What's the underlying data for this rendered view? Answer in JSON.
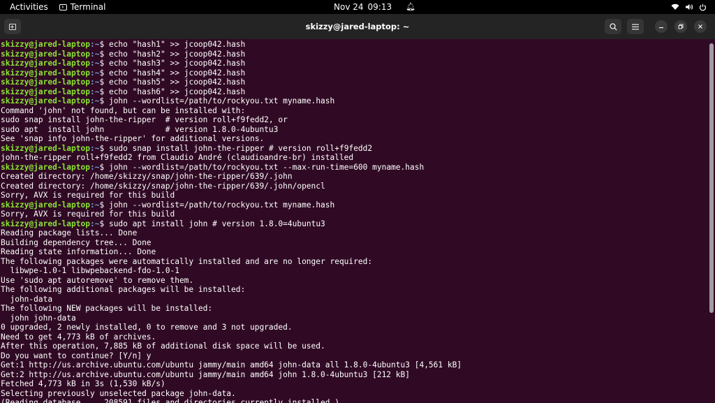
{
  "topbar": {
    "activities": "Activities",
    "app_name": "Terminal",
    "date": "Nov 24",
    "time": "09:13",
    "icons": [
      "bell-icon",
      "wifi-icon",
      "volume-icon",
      "power-icon"
    ]
  },
  "window": {
    "title": "skizzy@jared-laptop: ~",
    "icons": [
      "new-tab-icon",
      "search-icon",
      "hamburger-menu-icon",
      "minimize-icon",
      "maximize-icon",
      "close-icon"
    ]
  },
  "colors": {
    "background": "#300a24",
    "prompt_user": "#8ae234",
    "prompt_path": "#729fcf",
    "text": "#ffffff"
  },
  "prompt": {
    "user_host": "skizzy@jared-laptop",
    "path": ":~",
    "symbol": "$ "
  },
  "terminal_lines": [
    {
      "type": "cmd",
      "text": "echo \"hash1\" >> jcoop042.hash"
    },
    {
      "type": "cmd",
      "text": "echo \"hash2\" >> jcoop042.hash"
    },
    {
      "type": "cmd",
      "text": "echo \"hash3\" >> jcoop042.hash"
    },
    {
      "type": "cmd",
      "text": "echo \"hash4\" >> jcoop042.hash"
    },
    {
      "type": "cmd",
      "text": "echo \"hash5\" >> jcoop042.hash"
    },
    {
      "type": "cmd",
      "text": "echo \"hash6\" >> jcoop042.hash"
    },
    {
      "type": "cmd",
      "text": "john --wordlist=/path/to/rockyou.txt myname.hash"
    },
    {
      "type": "out",
      "text": "Command 'john' not found, but can be installed with:"
    },
    {
      "type": "out",
      "text": "sudo snap install john-the-ripper  # version roll+f9fedd2, or"
    },
    {
      "type": "out",
      "text": "sudo apt  install john             # version 1.8.0-4ubuntu3"
    },
    {
      "type": "out",
      "text": "See 'snap info john-the-ripper' for additional versions."
    },
    {
      "type": "cmd",
      "text": "sudo snap install john-the-ripper # version roll+f9fedd2"
    },
    {
      "type": "out",
      "text": "john-the-ripper roll+f9fedd2 from Claudio André (claudioandre-br) installed"
    },
    {
      "type": "cmd",
      "text": "john --wordlist=/path/to/rockyou.txt --max-run-time=600 myname.hash"
    },
    {
      "type": "out",
      "text": "Created directory: /home/skizzy/snap/john-the-ripper/639/.john"
    },
    {
      "type": "out",
      "text": "Created directory: /home/skizzy/snap/john-the-ripper/639/.john/opencl"
    },
    {
      "type": "out",
      "text": "Sorry, AVX is required for this build"
    },
    {
      "type": "cmd",
      "text": "john --wordlist=/path/to/rockyou.txt myname.hash"
    },
    {
      "type": "out",
      "text": "Sorry, AVX is required for this build"
    },
    {
      "type": "cmd",
      "text": "sudo apt install john # version 1.8.0=4ubuntu3"
    },
    {
      "type": "out",
      "text": "Reading package lists... Done"
    },
    {
      "type": "out",
      "text": "Building dependency tree... Done"
    },
    {
      "type": "out",
      "text": "Reading state information... Done"
    },
    {
      "type": "out",
      "text": "The following packages were automatically installed and are no longer required:"
    },
    {
      "type": "out",
      "text": "  libwpe-1.0-1 libwpebackend-fdo-1.0-1"
    },
    {
      "type": "out",
      "text": "Use 'sudo apt autoremove' to remove them."
    },
    {
      "type": "out",
      "text": "The following additional packages will be installed:"
    },
    {
      "type": "out",
      "text": "  john-data"
    },
    {
      "type": "out",
      "text": "The following NEW packages will be installed:"
    },
    {
      "type": "out",
      "text": "  john john-data"
    },
    {
      "type": "out",
      "text": "0 upgraded, 2 newly installed, 0 to remove and 3 not upgraded."
    },
    {
      "type": "out",
      "text": "Need to get 4,773 kB of archives."
    },
    {
      "type": "out",
      "text": "After this operation, 7,885 kB of additional disk space will be used."
    },
    {
      "type": "out",
      "text": "Do you want to continue? [Y/n] y"
    },
    {
      "type": "out",
      "text": "Get:1 http://us.archive.ubuntu.com/ubuntu jammy/main amd64 john-data all 1.8.0-4ubuntu3 [4,561 kB]"
    },
    {
      "type": "out",
      "text": "Get:2 http://us.archive.ubuntu.com/ubuntu jammy/main amd64 john 1.8.0-4ubuntu3 [212 kB]"
    },
    {
      "type": "out",
      "text": "Fetched 4,773 kB in 3s (1,530 kB/s)"
    },
    {
      "type": "out",
      "text": "Selecting previously unselected package john-data."
    },
    {
      "type": "out",
      "text": "(Reading database ... 208591 files and directories currently installed.)"
    }
  ]
}
